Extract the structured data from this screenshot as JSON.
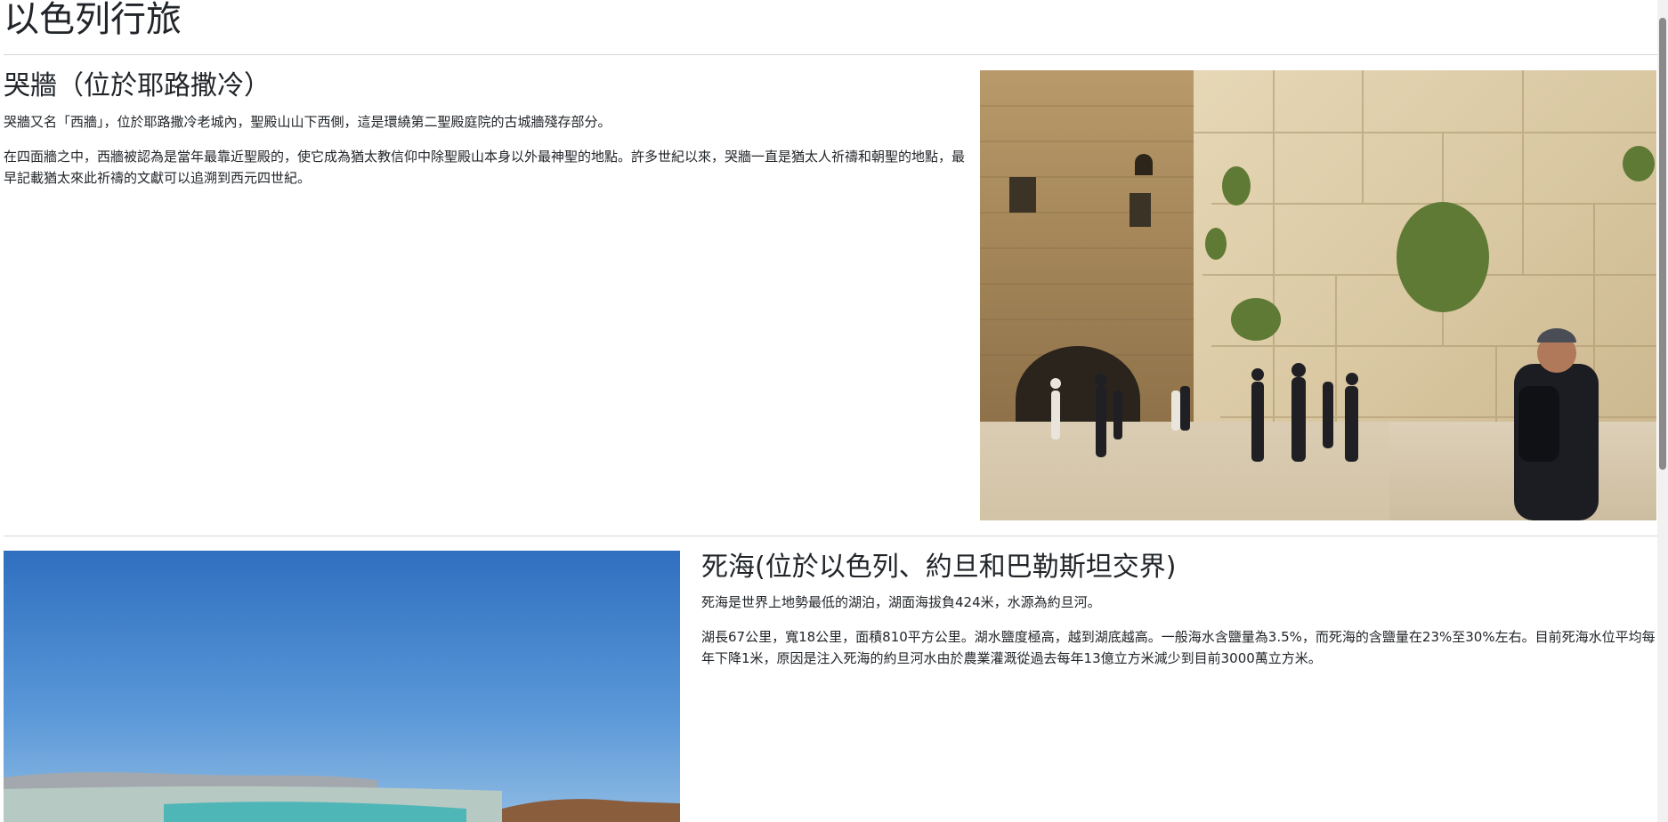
{
  "page": {
    "title": "以色列行旅"
  },
  "sections": [
    {
      "heading": "哭牆（位於耶路撒冷）",
      "paragraphs": [
        "哭牆又名「西牆」，位於耶路撒冷老城內，聖殿山山下西側，這是環繞第二聖殿庭院的古城牆殘存部分。",
        "在四面牆之中，西牆被認為是當年最靠近聖殿的，使它成為猶太教信仰中除聖殿山本身以外最神聖的地點。許多世紀以來，哭牆一直是猶太人祈禱和朝聖的地點，最早記載猶太來此祈禱的文獻可以追溯到西元四世紀。"
      ],
      "image": "western-wall-photo"
    },
    {
      "heading": "死海(位於以色列、約旦和巴勒斯坦交界)",
      "paragraphs": [
        "死海是世界上地勢最低的湖泊，湖面海拔負424米，水源為約旦河。",
        "湖長67公里，寬18公里，面積810平方公里。湖水鹽度極高，越到湖底越高。一般海水含鹽量為3.5%，而死海的含鹽量在23%至30%左右。目前死海水位平均每年下降1米，原因是注入死海的約旦河水由於農業灌溉從過去每年13億立方米減少到目前3000萬立方米。"
      ],
      "image": "dead-sea-photo"
    }
  ],
  "colors": {
    "text": "#212529",
    "divider": "#d8d8d8",
    "sky": "#3d7fcb",
    "wall_stone": "#d9c8a4"
  }
}
